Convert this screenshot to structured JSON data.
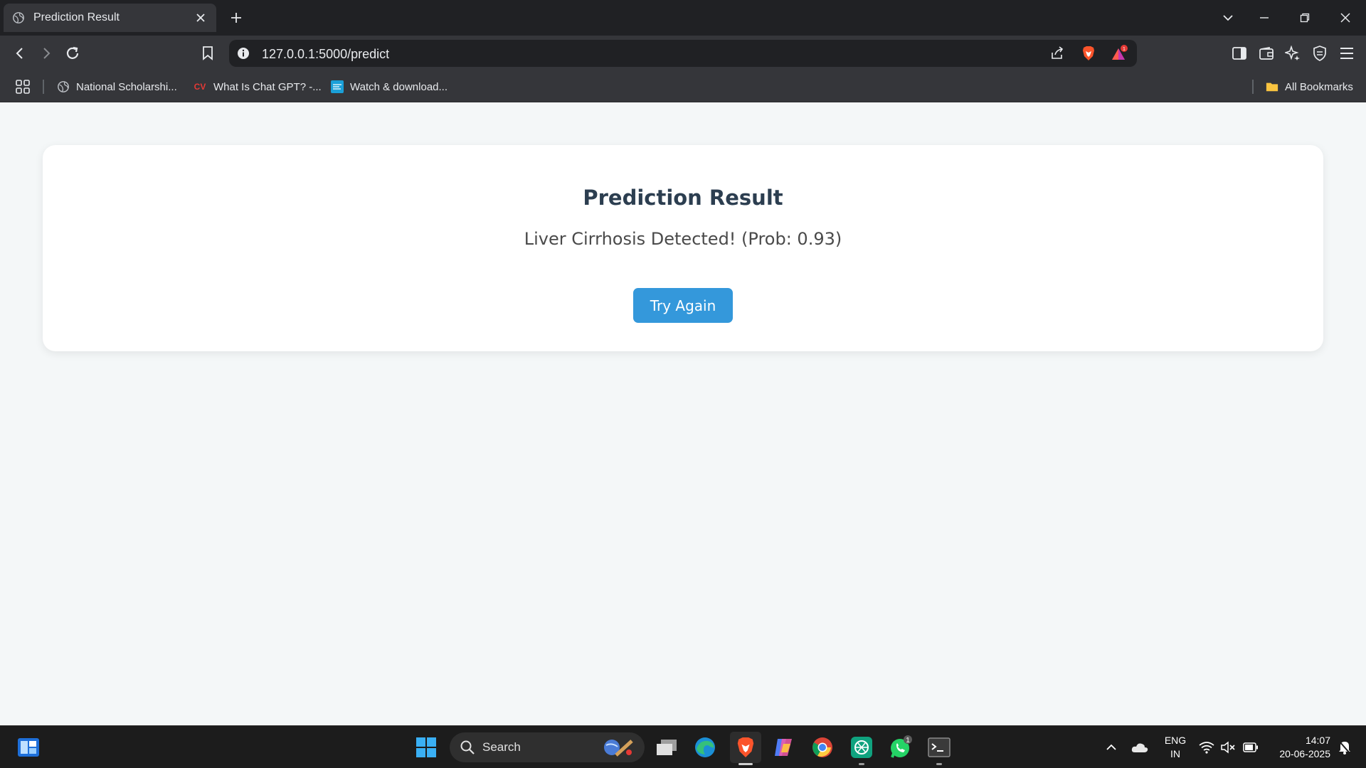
{
  "browser": {
    "tab_title": "Prediction Result",
    "url": "127.0.0.1:5000/predict",
    "notification_count": "1",
    "bookmarks": [
      {
        "label": "National Scholarshi..."
      },
      {
        "label": "What Is Chat GPT? -...",
        "icon_text": "CV"
      },
      {
        "label": "Watch & download..."
      }
    ],
    "all_bookmarks_label": "All Bookmarks"
  },
  "page": {
    "title": "Prediction Result",
    "result_text": "Liver Cirrhosis Detected! (Prob: 0.93)",
    "button_label": "Try Again",
    "colors": {
      "accent": "#3498db",
      "heading": "#2c3e50",
      "background": "#f4f7f8"
    }
  },
  "taskbar": {
    "search_label": "Search",
    "whatsapp_badge": "1",
    "language": "ENG",
    "region": "IN",
    "time": "14:07",
    "date": "20-06-2025"
  }
}
